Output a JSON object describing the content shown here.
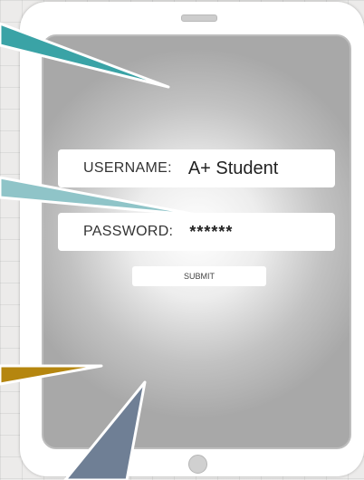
{
  "login_form": {
    "username_label": "USERNAME:",
    "username_value": "A+ Student",
    "password_label": "PASSWORD:",
    "password_value": "******",
    "submit_label": "SUBMIT"
  },
  "colors": {
    "callout_teal": "#3aa3a6",
    "callout_light_teal": "#8fc4c8",
    "callout_gold": "#b5860f",
    "callout_slate": "#6f7f95"
  }
}
